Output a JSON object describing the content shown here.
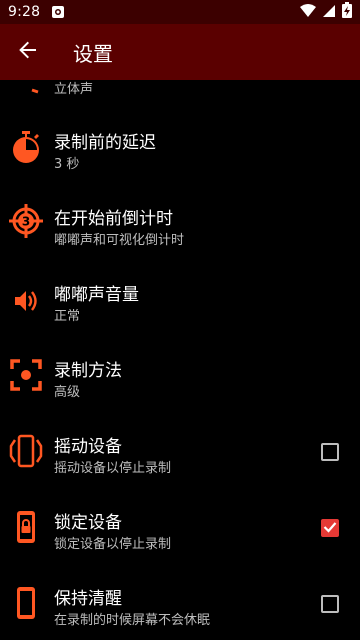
{
  "status_bar": {
    "time": "9:28",
    "icons": [
      "screenshot-icon",
      "wifi-icon",
      "signal-icon",
      "battery-charging-icon"
    ]
  },
  "app_bar": {
    "title": "设置",
    "back_icon": "arrow-back-icon"
  },
  "accent_color": "#ff5722",
  "settings": [
    {
      "title": "",
      "subtitle": "立体声",
      "icon": "partial-icon"
    },
    {
      "title": "录制前的延迟",
      "subtitle": "3 秒",
      "icon": "timer-icon"
    },
    {
      "title": "在开始前倒计时",
      "subtitle": "嘟嘟声和可视化倒计时",
      "icon": "countdown-icon"
    },
    {
      "title": "嘟嘟声音量",
      "subtitle": "正常",
      "icon": "volume-icon"
    },
    {
      "title": "录制方法",
      "subtitle": "高级",
      "icon": "center-focus-icon"
    },
    {
      "title": "摇动设备",
      "subtitle": "摇动设备以停止录制",
      "icon": "shake-phone-icon",
      "checked": false
    },
    {
      "title": "锁定设备",
      "subtitle": "锁定设备以停止录制",
      "icon": "lock-phone-icon",
      "checked": true
    },
    {
      "title": "保持清醒",
      "subtitle": "在录制的时候屏幕不会休眠",
      "icon": "phone-icon",
      "checked": false
    }
  ]
}
